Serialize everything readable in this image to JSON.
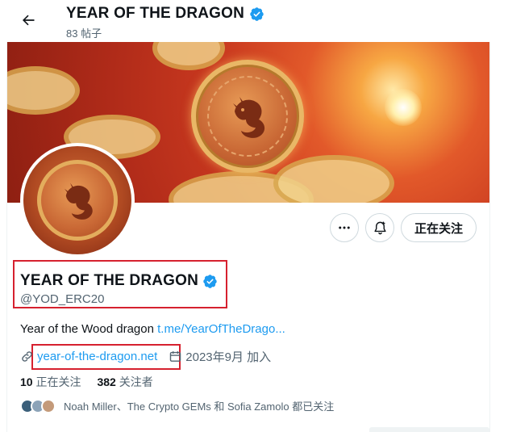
{
  "header": {
    "title": "YEAR OF THE DRAGON",
    "post_count": "83 帖子"
  },
  "actions": {
    "more_icon": "more-horizontal-icon",
    "notify_icon": "bell-plus-icon",
    "follow_label": "正在关注"
  },
  "profile": {
    "name": "YEAR OF THE DRAGON",
    "handle": "@YOD_ERC20",
    "bio_text": "Year of the Wood dragon ",
    "bio_link": "t.me/YearOfTheDrago...",
    "website": "year-of-the-dragon.net",
    "joined": "2023年9月 加入",
    "following_count": "10",
    "following_label": "正在关注",
    "followers_count": "382",
    "followers_label": "关注者",
    "mutual_followers": "Noah Miller、The Crypto GEMs 和 Sofia Zamolo 都已关注"
  },
  "colors": {
    "verified_blue": "#1d9bf0",
    "link_blue": "#1d9bf0",
    "highlight_red": "#d6212f",
    "banner_red": "#c8381f",
    "gold": "#e9b766"
  }
}
